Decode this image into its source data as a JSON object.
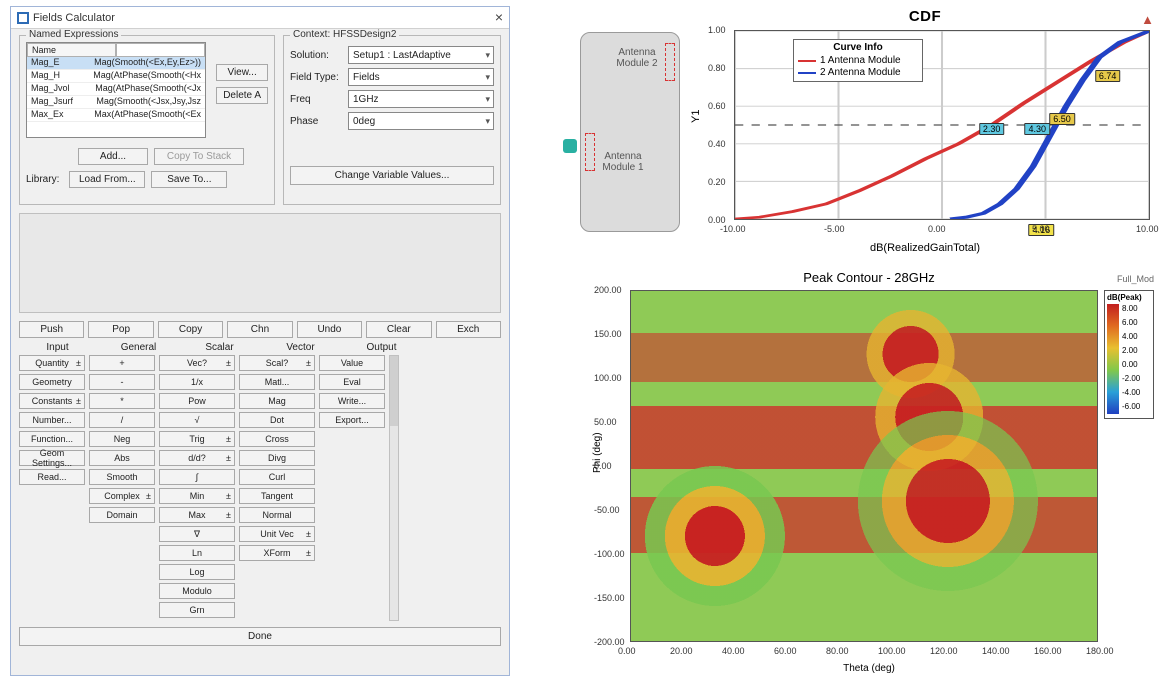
{
  "dialog": {
    "title": "Fields Calculator",
    "named_expr": {
      "legend": "Named Expressions",
      "header_name": "Name",
      "header_blank": "",
      "rows": [
        {
          "name": "Mag_E",
          "val": "Mag(Smooth(<Ex,Ey,Ez>))"
        },
        {
          "name": "Mag_H",
          "val": "Mag(AtPhase(Smooth(<Hx"
        },
        {
          "name": "Mag_Jvol",
          "val": "Mag(AtPhase(Smooth(<Jx"
        },
        {
          "name": "Mag_Jsurf",
          "val": "Mag(Smooth(<Jsx,Jsy,Jsz"
        },
        {
          "name": "Max_Ex",
          "val": "Max(AtPhase(Smooth(<Ex"
        }
      ],
      "btn_view": "View...",
      "btn_delete_all": "Delete A",
      "btn_add": "Add...",
      "btn_copy": "Copy To Stack",
      "btn_load": "Load From...",
      "btn_save": "Save To...",
      "library_label": "Library:"
    },
    "context": {
      "legend": "Context: HFSSDesign2",
      "rows": [
        {
          "label": "Solution:",
          "value": "Setup1 : LastAdaptive"
        },
        {
          "label": "Field Type:",
          "value": "Fields"
        },
        {
          "label": "Freq",
          "value": "1GHz"
        },
        {
          "label": "Phase",
          "value": "0deg"
        }
      ],
      "change_btn": "Change Variable Values..."
    },
    "toolbar": [
      "Push",
      "Pop",
      "Copy",
      "Chn",
      "Undo",
      "Clear",
      "Exch"
    ],
    "col_headers": [
      "Input",
      "General",
      "Scalar",
      "Vector",
      "Output"
    ],
    "cols": {
      "input": [
        "Quantity ±",
        "Geometry",
        "Constants ±",
        "Number...",
        "Function...",
        "Geom Settings...",
        "Read..."
      ],
      "general": [
        "+",
        "-",
        "*",
        "/",
        "Neg",
        "Abs",
        "Smooth",
        "Complex ±",
        "Domain"
      ],
      "scalar": [
        "Vec? ±",
        "1/x",
        "Pow",
        "√",
        "Trig ±",
        "d/d? ±",
        "∫",
        "Min ±",
        "Max ±",
        "∇",
        "Ln",
        "Log",
        "Modulo",
        "Grn"
      ],
      "vector": [
        "Scal? ±",
        "Matl...",
        "Mag",
        "Dot",
        "Cross",
        "Divg",
        "Curl",
        "Tangent",
        "Normal",
        "Unit Vec ±",
        "XForm ±"
      ],
      "output": [
        "Value",
        "Eval",
        "Write...",
        "Export..."
      ]
    },
    "ok": "Done"
  },
  "phone": {
    "mod1": "Antenna Module 1",
    "mod2": "Antenna Module 2"
  },
  "cdf": {
    "title": "CDF",
    "xlabel": "dB(RealizedGainTotal)",
    "ylabel": "Y1",
    "legend_title": "Curve Info",
    "series": [
      {
        "name": "1 Antenna Module",
        "color": "#d83333"
      },
      {
        "name": "2 Antenna Module",
        "color": "#2142c5"
      }
    ],
    "markers": [
      {
        "text": "2.30",
        "bg": "#5fc8e0",
        "x": 0.62,
        "y": 0.52
      },
      {
        "text": "4.30",
        "bg": "#5fc8e0",
        "x": 0.73,
        "y": 0.52
      },
      {
        "text": "6.50",
        "bg": "#e6c84a",
        "x": 0.79,
        "y": 0.47
      },
      {
        "text": "6.74",
        "bg": "#e6c84a",
        "x": 0.9,
        "y": 0.24
      },
      {
        "text": "4.16",
        "bg": "#f2e24a",
        "x": 0.74,
        "y": 1.06
      }
    ],
    "y_ticks": [
      "0.00",
      "0.20",
      "0.40",
      "0.60",
      "0.80",
      "1.00"
    ],
    "x_ticks": [
      "-10.00",
      "-5.00",
      "0.00",
      "5.00",
      "10.00"
    ]
  },
  "heatmap": {
    "title": "Peak Contour - 28GHz",
    "field": "Full_Mod",
    "var": "dB(Peak)",
    "xlabel": "Theta (deg)",
    "ylabel": "Phi (deg)",
    "x_ticks": [
      "0.00",
      "20.00",
      "40.00",
      "60.00",
      "80.00",
      "100.00",
      "120.00",
      "140.00",
      "160.00",
      "180.00"
    ],
    "y_ticks": [
      "-200.00",
      "-150.00",
      "-100.00",
      "-50.00",
      "0.00",
      "50.00",
      "100.00",
      "150.00",
      "200.00"
    ],
    "legend_steps": [
      "8.00",
      "6.00",
      "4.00",
      "2.00",
      "0.00",
      "-2.00",
      "-4.00",
      "-6.00"
    ]
  },
  "chart_data": [
    {
      "type": "line",
      "title": "CDF",
      "xlabel": "dB(RealizedGainTotal)",
      "ylabel": "Y1",
      "xlim": [
        -13,
        10
      ],
      "ylim": [
        0,
        1
      ],
      "series": [
        {
          "name": "1 Antenna Module",
          "color": "#d83333",
          "x": [
            -13,
            -10,
            -7,
            -5,
            -3,
            -1,
            0,
            2,
            4,
            6,
            8,
            10
          ],
          "y": [
            0.0,
            0.02,
            0.07,
            0.13,
            0.22,
            0.35,
            0.42,
            0.56,
            0.7,
            0.83,
            0.93,
            1.0
          ]
        },
        {
          "name": "2 Antenna Module",
          "color": "#2142c5",
          "x": [
            -1,
            0,
            1,
            2,
            3,
            4,
            5,
            6,
            7,
            8,
            9,
            10
          ],
          "y": [
            0.0,
            0.01,
            0.03,
            0.07,
            0.15,
            0.28,
            0.44,
            0.6,
            0.75,
            0.88,
            0.96,
            1.0
          ]
        }
      ],
      "hline": {
        "y": 0.5,
        "style": "dashed"
      },
      "annotations": [
        {
          "text": "2.30",
          "x": 2.3,
          "y": 0.5
        },
        {
          "text": "4.30",
          "x": 4.3,
          "y": 0.5
        },
        {
          "text": "6.50",
          "x": 6.5,
          "y": 0.5
        },
        {
          "text": "6.74",
          "x": 6.74,
          "y": 0.75
        },
        {
          "text": "4.16",
          "x": 4.16,
          "y": 0.0
        }
      ]
    },
    {
      "type": "heatmap",
      "title": "Peak Contour - 28GHz",
      "xlabel": "Theta (deg)",
      "ylabel": "Phi (deg)",
      "xlim": [
        0,
        180
      ],
      "ylim": [
        -200,
        200
      ],
      "colorbar": {
        "label": "dB(Peak)",
        "min": -6,
        "max": 8
      }
    }
  ]
}
